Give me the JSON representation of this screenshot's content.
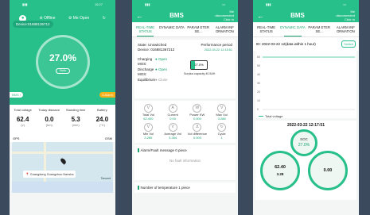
{
  "accent": "#27c08a",
  "phone1": {
    "status_time": "15:27",
    "offline_label": "Offline",
    "me_open_label": "Me Open",
    "device_id": "Device:01688136712",
    "soc_percent": "27.0%",
    "state": "Static",
    "bms_badge": "BMS",
    "warn_badge": "0 Alarm",
    "stats": [
      {
        "label": "Total voltage",
        "value": "62.4",
        "unit": "(v)"
      },
      {
        "label": "Today distance",
        "value": "0.0",
        "unit": "(km)"
      },
      {
        "label": "Standing time",
        "value": "5.3",
        "unit": "(min)"
      },
      {
        "label": "Battery",
        "value": "24.0",
        "unit": "(°C)"
      }
    ],
    "gps": "GPS",
    "gsm": "GSM",
    "map_label": "Guangdong Guangzhou Nansha",
    "tencent": "Tencent"
  },
  "phone2": {
    "title": "BMS",
    "conn_status": "Me disconnected Click to",
    "tabs": [
      "REAL-TIME STATUS",
      "DYNAMIC DATA",
      "PARAM ETER SE...",
      "ALARM INF ORMATION"
    ],
    "state_label": "State: Unswitched",
    "device": "Device: 016881367212",
    "perf_label": "Performance period",
    "perf_value": "2022-03-22 12:15:51",
    "charging_label": "Charging MOS:",
    "charging_val": "Open",
    "discharge_label": "Discharge MOS:",
    "discharge_val": "Open",
    "equil_label": "Equilibrium",
    "equil_val": "Close",
    "battery_pct": "27.0%",
    "surplus": "Surplus capacity 40.5AH",
    "metrics": [
      {
        "label": "Total Vol",
        "value": "62.400",
        "icon": "V"
      },
      {
        "label": "Current",
        "value": "0.00",
        "icon": "A"
      },
      {
        "label": "Power KW",
        "value": "0.000",
        "icon": "W"
      },
      {
        "label": "Max Vol",
        "value": "3.288",
        "icon": "V"
      },
      {
        "label": "Min Vol",
        "value": "3.285",
        "icon": "V"
      },
      {
        "label": "Average Vol",
        "value": "3.284",
        "icon": "V"
      },
      {
        "label": "Vol difference",
        "value": "0.003",
        "icon": "Δ"
      },
      {
        "label": "Cycle",
        "value": "1",
        "icon": "↻"
      }
    ],
    "alarm_title": "Alarm/Fault message 0 piece",
    "no_fault": "No fault information",
    "temp_title": "Number of temperature 1 piece"
  },
  "phone3": {
    "title": "BMS",
    "conn_status": "Me disconnected Click to",
    "tabs": [
      "REAL-TIME STATUS",
      "DYNAMIC DATA",
      "PARAM ETER SE...",
      "ALARM INF ORMATION"
    ],
    "id_line": "ID: 2022-03-22 12(data within 1 hour)",
    "switch": "Switch",
    "y_ticks": [
      "60",
      "50",
      "40",
      "30",
      "20",
      "10",
      "0"
    ],
    "legend": "Total voltage",
    "datetime": "2022-03-22 12:17:51",
    "soc_label": "SOC",
    "soc_value": "27.0%",
    "gauge_left_value": "62.40",
    "gauge_left_sub": "3.28",
    "gauge_right_value": "0.00"
  }
}
